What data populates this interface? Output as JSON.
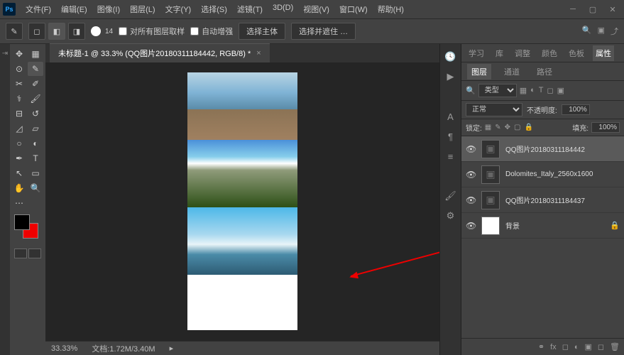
{
  "app": {
    "logo": "Ps"
  },
  "menu": {
    "file": "文件(F)",
    "edit": "编辑(E)",
    "image": "图像(I)",
    "layer": "图层(L)",
    "type": "文字(Y)",
    "select": "选择(S)",
    "filter": "滤镜(T)",
    "threeD": "3D(D)",
    "view": "视图(V)",
    "window": "窗口(W)",
    "help": "帮助(H)"
  },
  "options": {
    "brush_size": "14",
    "sample_all_layers": "对所有图层取样",
    "auto_enhance": "自动增强",
    "select_subject": "选择主体",
    "select_and_mask": "选择并遮住 …"
  },
  "document": {
    "tab_title": "未标题-1 @ 33.3% (QQ图片20180311184442, RGB/8) *",
    "zoom": "33.33%",
    "doc_info": "文档:1.72M/3.40M"
  },
  "panels": {
    "top_tabs": {
      "learn": "学习",
      "library": "库",
      "adjust": "调整",
      "color": "颜色",
      "swatches": "色板",
      "properties": "属性"
    },
    "sub_tabs": {
      "layers": "图层",
      "channels": "通道",
      "paths": "路径"
    },
    "filter_label": "类型",
    "blend_mode": "正常",
    "opacity_label": "不透明度:",
    "opacity_value": "100%",
    "lock_label": "锁定:",
    "fill_label": "填充:",
    "fill_value": "100%",
    "layers": [
      {
        "name": "QQ图片20180311184442",
        "visible": true,
        "selected": true,
        "smart": true
      },
      {
        "name": "Dolomites_Italy_2560x1600",
        "visible": true,
        "selected": false,
        "smart": true
      },
      {
        "name": "QQ图片20180311184437",
        "visible": true,
        "selected": false,
        "smart": true
      },
      {
        "name": "背景",
        "visible": true,
        "selected": false,
        "locked": true
      }
    ]
  },
  "colors": {
    "foreground": "#000000",
    "background": "#e00000"
  }
}
